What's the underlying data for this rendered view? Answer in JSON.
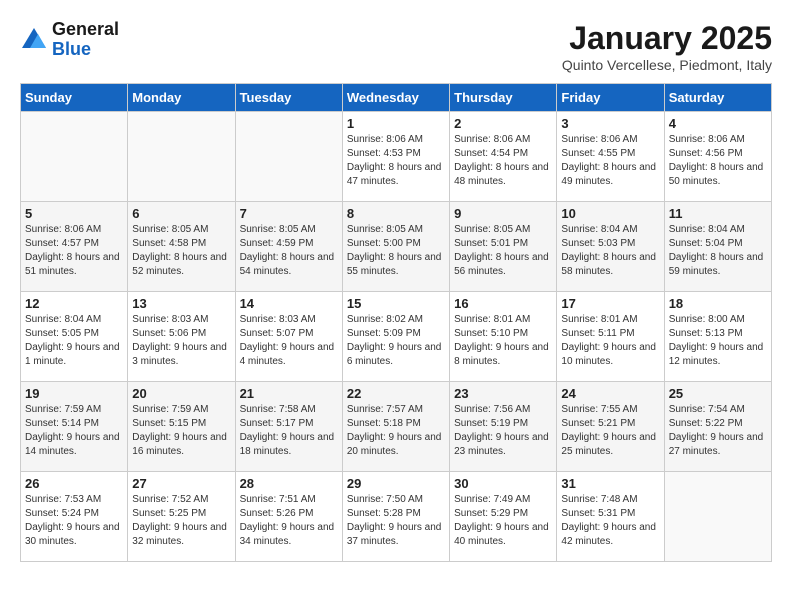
{
  "header": {
    "logo_line1": "General",
    "logo_line2": "Blue",
    "month": "January 2025",
    "location": "Quinto Vercellese, Piedmont, Italy"
  },
  "weekdays": [
    "Sunday",
    "Monday",
    "Tuesday",
    "Wednesday",
    "Thursday",
    "Friday",
    "Saturday"
  ],
  "weeks": [
    [
      {
        "day": "",
        "info": ""
      },
      {
        "day": "",
        "info": ""
      },
      {
        "day": "",
        "info": ""
      },
      {
        "day": "1",
        "info": "Sunrise: 8:06 AM\nSunset: 4:53 PM\nDaylight: 8 hours and 47 minutes."
      },
      {
        "day": "2",
        "info": "Sunrise: 8:06 AM\nSunset: 4:54 PM\nDaylight: 8 hours and 48 minutes."
      },
      {
        "day": "3",
        "info": "Sunrise: 8:06 AM\nSunset: 4:55 PM\nDaylight: 8 hours and 49 minutes."
      },
      {
        "day": "4",
        "info": "Sunrise: 8:06 AM\nSunset: 4:56 PM\nDaylight: 8 hours and 50 minutes."
      }
    ],
    [
      {
        "day": "5",
        "info": "Sunrise: 8:06 AM\nSunset: 4:57 PM\nDaylight: 8 hours and 51 minutes."
      },
      {
        "day": "6",
        "info": "Sunrise: 8:05 AM\nSunset: 4:58 PM\nDaylight: 8 hours and 52 minutes."
      },
      {
        "day": "7",
        "info": "Sunrise: 8:05 AM\nSunset: 4:59 PM\nDaylight: 8 hours and 54 minutes."
      },
      {
        "day": "8",
        "info": "Sunrise: 8:05 AM\nSunset: 5:00 PM\nDaylight: 8 hours and 55 minutes."
      },
      {
        "day": "9",
        "info": "Sunrise: 8:05 AM\nSunset: 5:01 PM\nDaylight: 8 hours and 56 minutes."
      },
      {
        "day": "10",
        "info": "Sunrise: 8:04 AM\nSunset: 5:03 PM\nDaylight: 8 hours and 58 minutes."
      },
      {
        "day": "11",
        "info": "Sunrise: 8:04 AM\nSunset: 5:04 PM\nDaylight: 8 hours and 59 minutes."
      }
    ],
    [
      {
        "day": "12",
        "info": "Sunrise: 8:04 AM\nSunset: 5:05 PM\nDaylight: 9 hours and 1 minute."
      },
      {
        "day": "13",
        "info": "Sunrise: 8:03 AM\nSunset: 5:06 PM\nDaylight: 9 hours and 3 minutes."
      },
      {
        "day": "14",
        "info": "Sunrise: 8:03 AM\nSunset: 5:07 PM\nDaylight: 9 hours and 4 minutes."
      },
      {
        "day": "15",
        "info": "Sunrise: 8:02 AM\nSunset: 5:09 PM\nDaylight: 9 hours and 6 minutes."
      },
      {
        "day": "16",
        "info": "Sunrise: 8:01 AM\nSunset: 5:10 PM\nDaylight: 9 hours and 8 minutes."
      },
      {
        "day": "17",
        "info": "Sunrise: 8:01 AM\nSunset: 5:11 PM\nDaylight: 9 hours and 10 minutes."
      },
      {
        "day": "18",
        "info": "Sunrise: 8:00 AM\nSunset: 5:13 PM\nDaylight: 9 hours and 12 minutes."
      }
    ],
    [
      {
        "day": "19",
        "info": "Sunrise: 7:59 AM\nSunset: 5:14 PM\nDaylight: 9 hours and 14 minutes."
      },
      {
        "day": "20",
        "info": "Sunrise: 7:59 AM\nSunset: 5:15 PM\nDaylight: 9 hours and 16 minutes."
      },
      {
        "day": "21",
        "info": "Sunrise: 7:58 AM\nSunset: 5:17 PM\nDaylight: 9 hours and 18 minutes."
      },
      {
        "day": "22",
        "info": "Sunrise: 7:57 AM\nSunset: 5:18 PM\nDaylight: 9 hours and 20 minutes."
      },
      {
        "day": "23",
        "info": "Sunrise: 7:56 AM\nSunset: 5:19 PM\nDaylight: 9 hours and 23 minutes."
      },
      {
        "day": "24",
        "info": "Sunrise: 7:55 AM\nSunset: 5:21 PM\nDaylight: 9 hours and 25 minutes."
      },
      {
        "day": "25",
        "info": "Sunrise: 7:54 AM\nSunset: 5:22 PM\nDaylight: 9 hours and 27 minutes."
      }
    ],
    [
      {
        "day": "26",
        "info": "Sunrise: 7:53 AM\nSunset: 5:24 PM\nDaylight: 9 hours and 30 minutes."
      },
      {
        "day": "27",
        "info": "Sunrise: 7:52 AM\nSunset: 5:25 PM\nDaylight: 9 hours and 32 minutes."
      },
      {
        "day": "28",
        "info": "Sunrise: 7:51 AM\nSunset: 5:26 PM\nDaylight: 9 hours and 34 minutes."
      },
      {
        "day": "29",
        "info": "Sunrise: 7:50 AM\nSunset: 5:28 PM\nDaylight: 9 hours and 37 minutes."
      },
      {
        "day": "30",
        "info": "Sunrise: 7:49 AM\nSunset: 5:29 PM\nDaylight: 9 hours and 40 minutes."
      },
      {
        "day": "31",
        "info": "Sunrise: 7:48 AM\nSunset: 5:31 PM\nDaylight: 9 hours and 42 minutes."
      },
      {
        "day": "",
        "info": ""
      }
    ]
  ]
}
